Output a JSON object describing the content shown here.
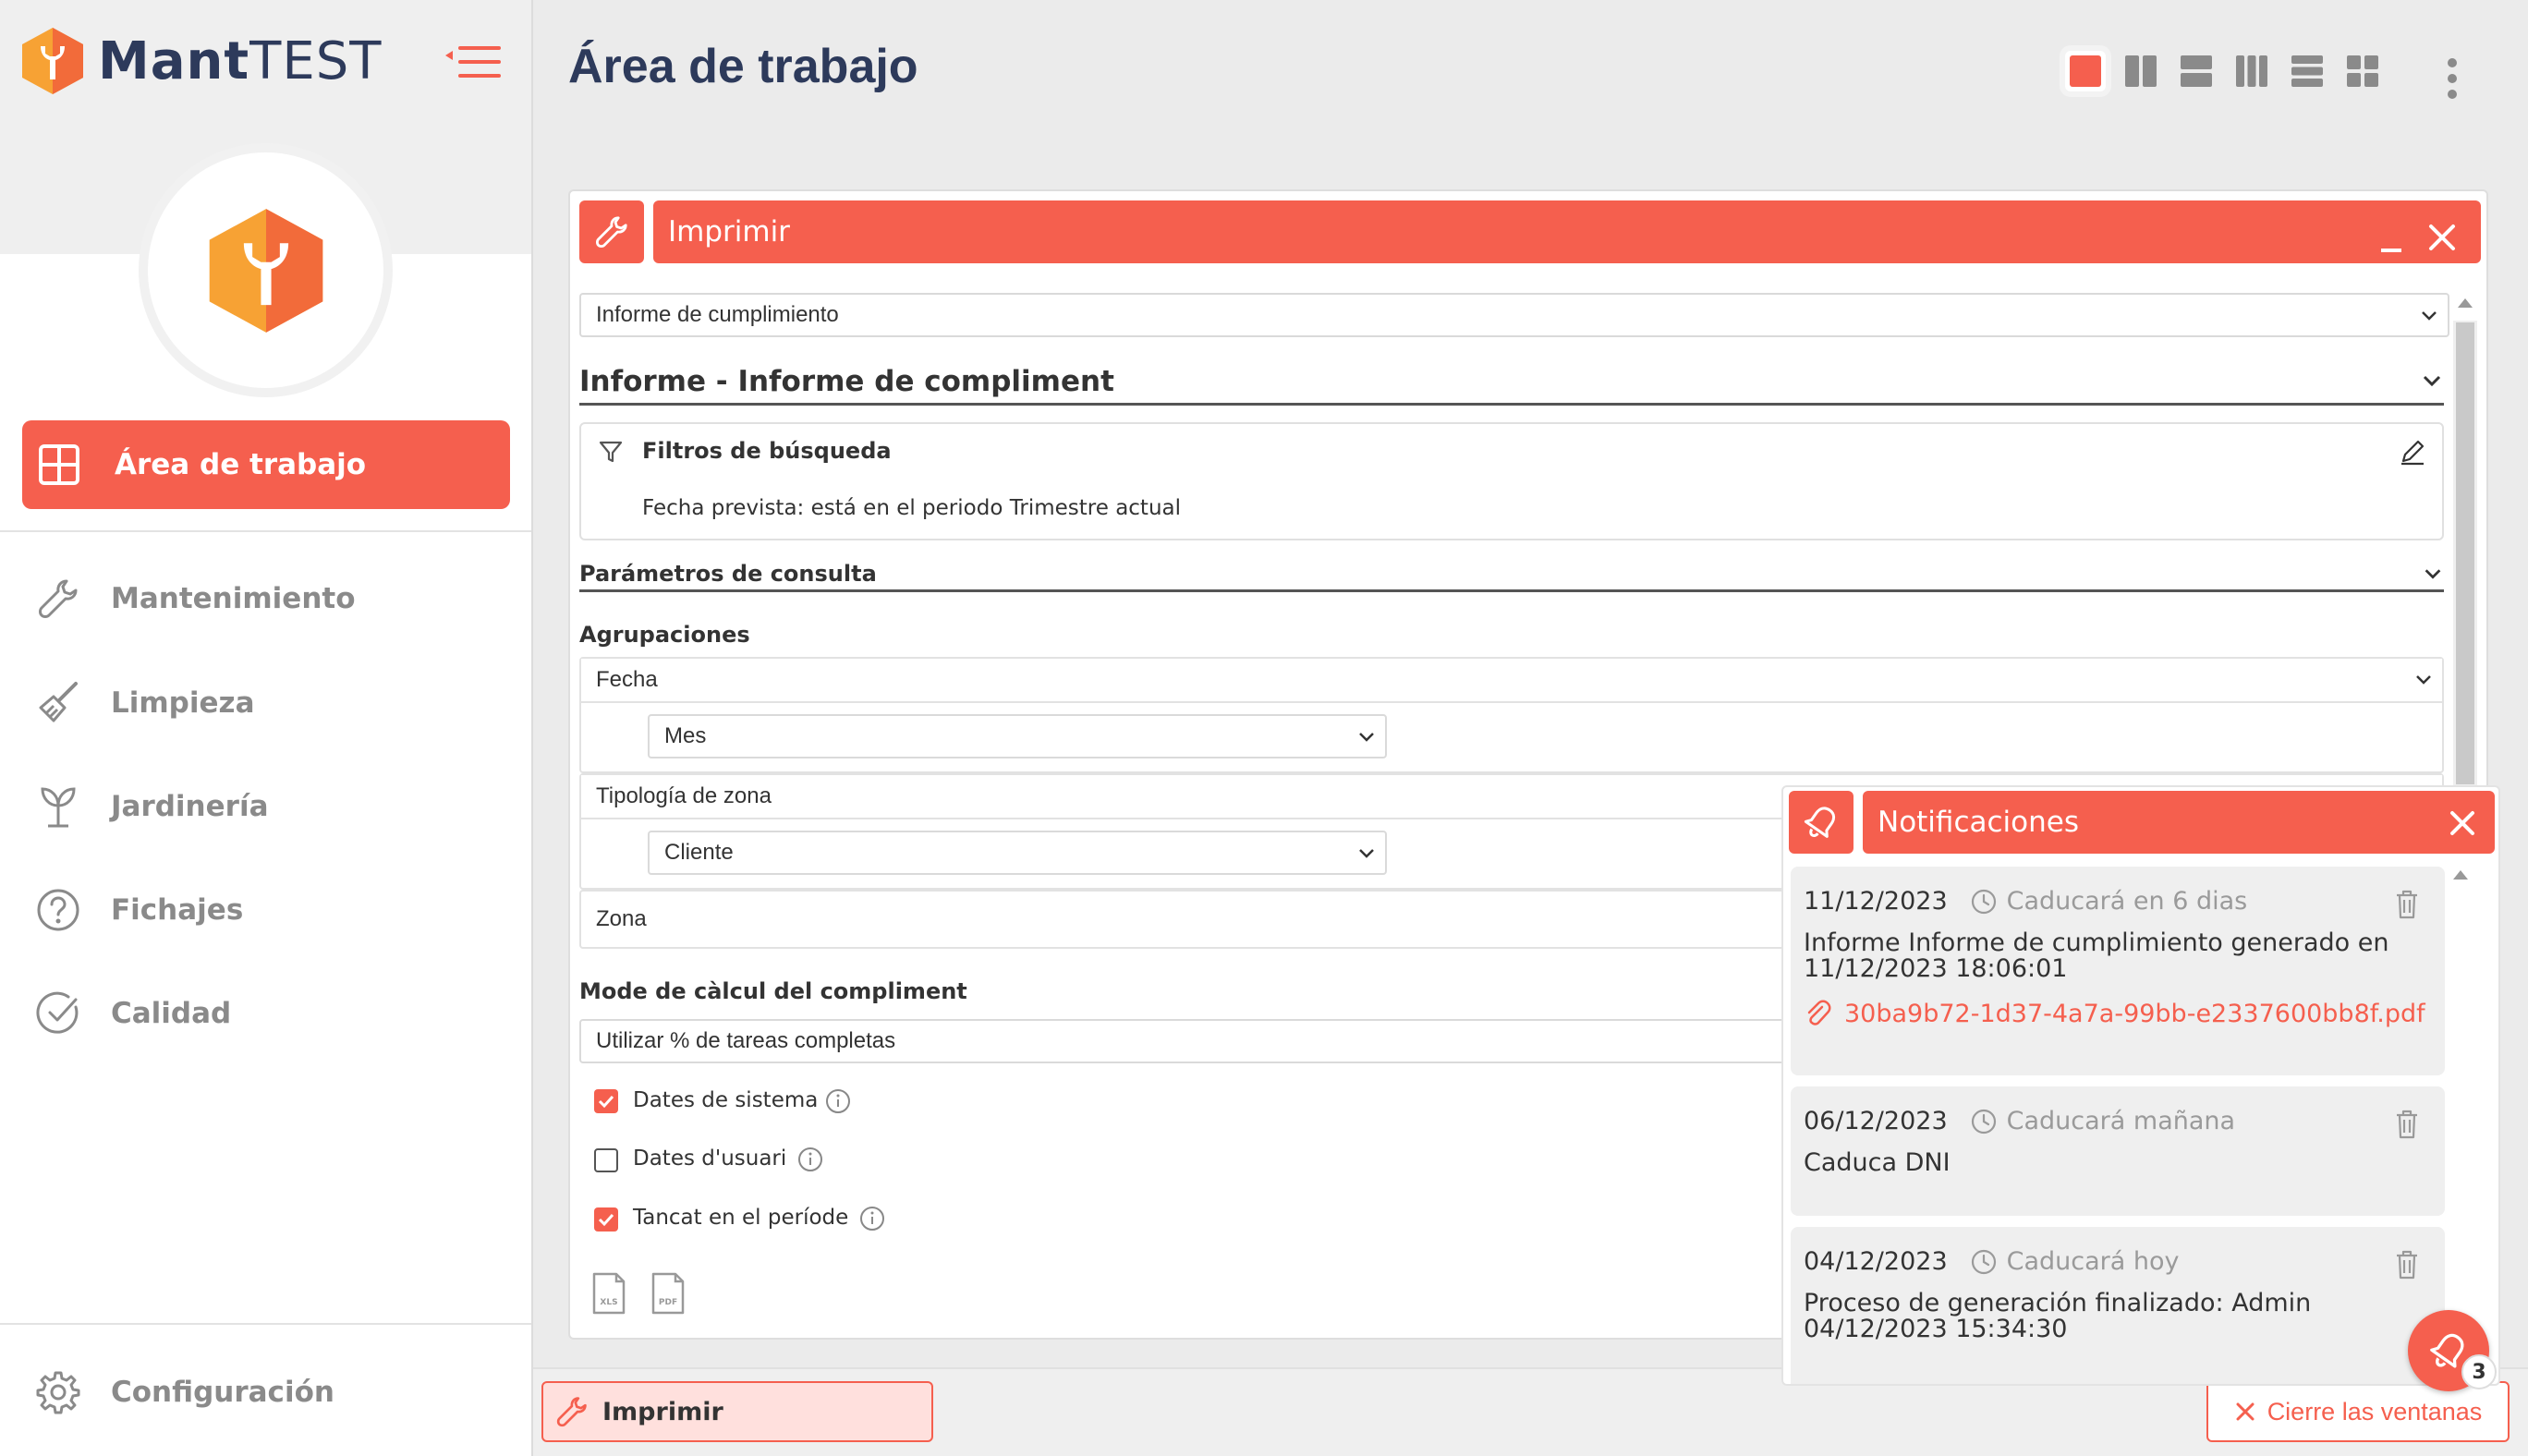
{
  "app": {
    "logo_bold": "Mant",
    "logo_light": "TEST"
  },
  "sidebar": {
    "active_item": "Área de trabajo",
    "items": [
      "Mantenimiento",
      "Limpieza",
      "Jardinería",
      "Fichajes",
      "Calidad"
    ],
    "settings": "Configuración"
  },
  "header": {
    "title": "Área de trabajo"
  },
  "print_window": {
    "title": "Imprimir",
    "report_select": "Informe de cumplimiento",
    "report_heading": "Informe - Informe de compliment",
    "filters_title": "Filtros de búsqueda",
    "filters_text": "Fecha prevista: está en el periodo Trimestre actual",
    "params_title": "Parámetros de consulta",
    "groupings_label": "Agrupaciones",
    "groupings": [
      {
        "field": "Fecha",
        "sub": "Mes"
      },
      {
        "field": "Tipología de zona",
        "sub": "Cliente"
      },
      {
        "field": "Zona"
      }
    ],
    "calc_mode_label": "Mode de càlcul del compliment",
    "calc_mode_value": "Utilizar % de tareas completas",
    "checkboxes": [
      {
        "label": "Dates de sistema",
        "checked": true
      },
      {
        "label": "Dates d'usuari",
        "checked": false
      },
      {
        "label": "Tancat en el període",
        "checked": true
      }
    ],
    "export_icons": [
      "XLS",
      "PDF"
    ]
  },
  "bottom_bar": {
    "task_label": "Imprimir",
    "close_all": "Cierre las ventanas"
  },
  "notifications": {
    "title": "Notificaciones",
    "items": [
      {
        "date": "11/12/2023",
        "expires": "Caducará en 6 dias",
        "message": "Informe Informe de cumplimiento generado en 11/12/2023 18:06:01",
        "attachment": "30ba9b72-1d37-4a7a-99bb-e2337600bb8f.pdf"
      },
      {
        "date": "06/12/2023",
        "expires": "Caducará mañana",
        "message": "Caduca DNI"
      },
      {
        "date": "04/12/2023",
        "expires": "Caducará hoy",
        "message": "Proceso de generación finalizado: Admin 04/12/2023 15:34:30"
      }
    ],
    "badge_count": "3"
  },
  "colors": {
    "accent": "#f55f4e",
    "brand_dark": "#2d3a5b",
    "logo_orange": "#f7a234"
  }
}
